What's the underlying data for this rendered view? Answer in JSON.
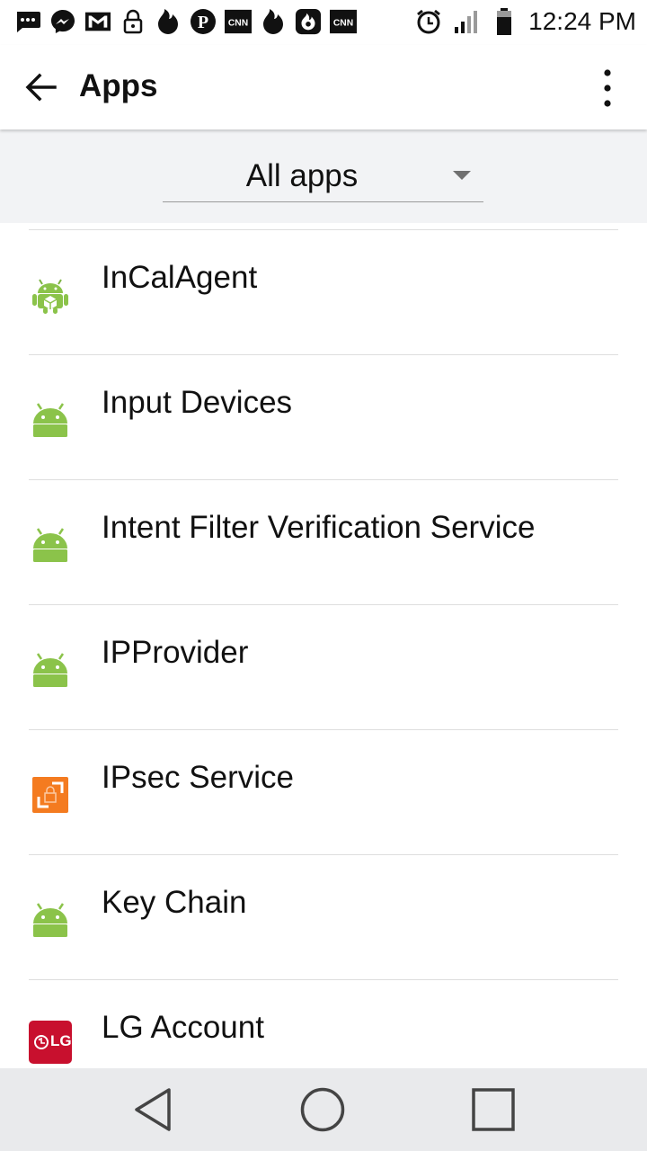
{
  "status_bar": {
    "time": "12:24 PM",
    "notification_icons": [
      "sms-icon",
      "messenger-icon",
      "gmail-icon",
      "lock-icon",
      "tinder-icon",
      "pinterest-icon",
      "cnn-icon",
      "tinder-icon",
      "tinder-app-icon",
      "cnn-icon"
    ],
    "system_icons": [
      "alarm-icon",
      "signal-icon",
      "battery-icon"
    ]
  },
  "app_bar": {
    "title": "Apps"
  },
  "filter": {
    "selected": "All apps"
  },
  "apps": [
    {
      "label": "InCalAgent",
      "icon": "android-box-icon"
    },
    {
      "label": "Input Devices",
      "icon": "android-icon"
    },
    {
      "label": "Intent Filter Verification Service",
      "icon": "android-icon"
    },
    {
      "label": "IPProvider",
      "icon": "android-icon"
    },
    {
      "label": "IPsec Service",
      "icon": "ipsec-lock-icon"
    },
    {
      "label": "Key Chain",
      "icon": "android-icon"
    },
    {
      "label": "LG Account",
      "icon": "lg-logo-icon",
      "icon_text": "LG"
    }
  ],
  "nav_bar": {
    "buttons": [
      "back-icon",
      "home-icon",
      "recents-icon"
    ]
  },
  "colors": {
    "android_green": "#8bc34a",
    "ipsec_orange": "#f47b20",
    "lg_red": "#c8102e"
  }
}
